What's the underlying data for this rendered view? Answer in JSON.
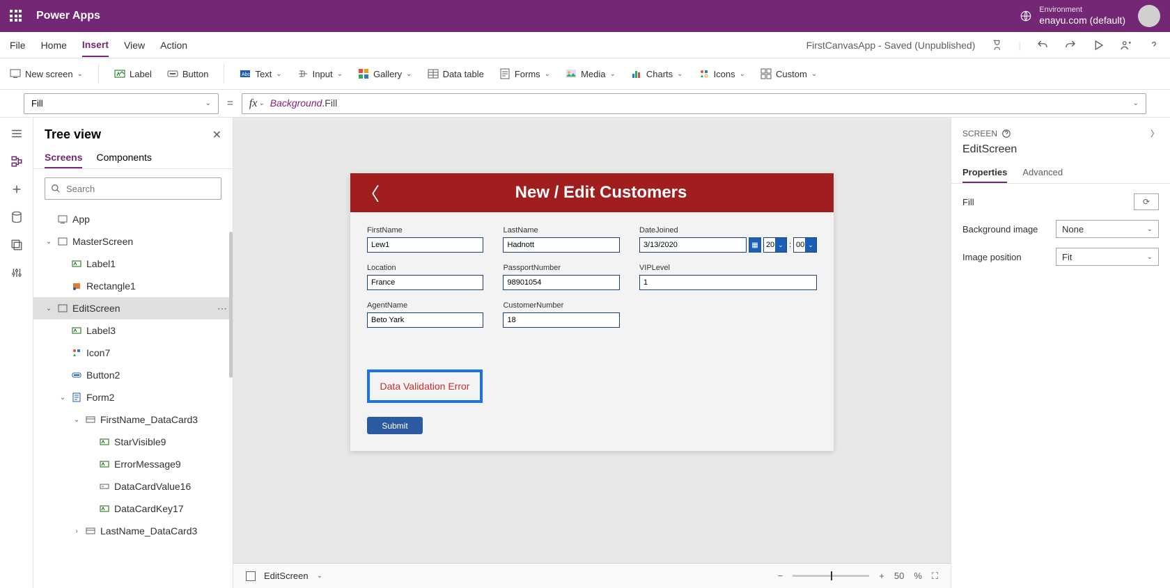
{
  "header": {
    "app_name": "Power Apps",
    "env_label": "Environment",
    "env_name": "enayu.com (default)"
  },
  "menu": {
    "items": [
      "File",
      "Home",
      "Insert",
      "View",
      "Action"
    ],
    "active_index": 2,
    "app_title": "FirstCanvasApp - Saved (Unpublished)"
  },
  "ribbon": {
    "new_screen": "New screen",
    "label": "Label",
    "button": "Button",
    "text": "Text",
    "input": "Input",
    "gallery": "Gallery",
    "data_table": "Data table",
    "forms": "Forms",
    "media": "Media",
    "charts": "Charts",
    "icons": "Icons",
    "custom": "Custom"
  },
  "formula": {
    "property": "Fill",
    "expr_obj": "Background",
    "expr_prop": ".Fill"
  },
  "tree": {
    "title": "Tree view",
    "tabs": [
      "Screens",
      "Components"
    ],
    "active_tab": 0,
    "search_placeholder": "Search",
    "items": [
      {
        "label": "App",
        "indent": 0,
        "icon": "app",
        "caret": ""
      },
      {
        "label": "MasterScreen",
        "indent": 0,
        "icon": "screen",
        "caret": "v"
      },
      {
        "label": "Label1",
        "indent": 1,
        "icon": "label",
        "caret": ""
      },
      {
        "label": "Rectangle1",
        "indent": 1,
        "icon": "rect",
        "caret": ""
      },
      {
        "label": "EditScreen",
        "indent": 0,
        "icon": "screen",
        "caret": "v",
        "selected": true,
        "dots": true
      },
      {
        "label": "Label3",
        "indent": 1,
        "icon": "label",
        "caret": ""
      },
      {
        "label": "Icon7",
        "indent": 1,
        "icon": "icons",
        "caret": ""
      },
      {
        "label": "Button2",
        "indent": 1,
        "icon": "button",
        "caret": ""
      },
      {
        "label": "Form2",
        "indent": 1,
        "icon": "form",
        "caret": "v"
      },
      {
        "label": "FirstName_DataCard3",
        "indent": 2,
        "icon": "card",
        "caret": "v"
      },
      {
        "label": "StarVisible9",
        "indent": 3,
        "icon": "label",
        "caret": ""
      },
      {
        "label": "ErrorMessage9",
        "indent": 3,
        "icon": "label",
        "caret": ""
      },
      {
        "label": "DataCardValue16",
        "indent": 3,
        "icon": "input",
        "caret": ""
      },
      {
        "label": "DataCardKey17",
        "indent": 3,
        "icon": "label",
        "caret": ""
      },
      {
        "label": "LastName_DataCard3",
        "indent": 2,
        "icon": "card",
        "caret": ">"
      }
    ]
  },
  "canvas": {
    "title": "New / Edit Customers",
    "fields": {
      "firstname_label": "FirstName",
      "firstname_value": "Lew1",
      "lastname_label": "LastName",
      "lastname_value": "Hadnott",
      "datejoined_label": "DateJoined",
      "datejoined_value": "3/13/2020",
      "date_hour": "20",
      "date_min": "00",
      "location_label": "Location",
      "location_value": "France",
      "passport_label": "PassportNumber",
      "passport_value": "98901054",
      "vip_label": "VIPLevel",
      "vip_value": "1",
      "agent_label": "AgentName",
      "agent_value": "Beto Yark",
      "custnum_label": "CustomerNumber",
      "custnum_value": "18"
    },
    "error_text": "Data Validation Error",
    "submit": "Submit"
  },
  "footer": {
    "screen": "EditScreen",
    "zoom": "50",
    "zoom_unit": "%"
  },
  "props": {
    "section": "SCREEN",
    "name": "EditScreen",
    "tabs": [
      "Properties",
      "Advanced"
    ],
    "active_tab": 0,
    "fill_label": "Fill",
    "bg_label": "Background image",
    "bg_value": "None",
    "pos_label": "Image position",
    "pos_value": "Fit"
  }
}
